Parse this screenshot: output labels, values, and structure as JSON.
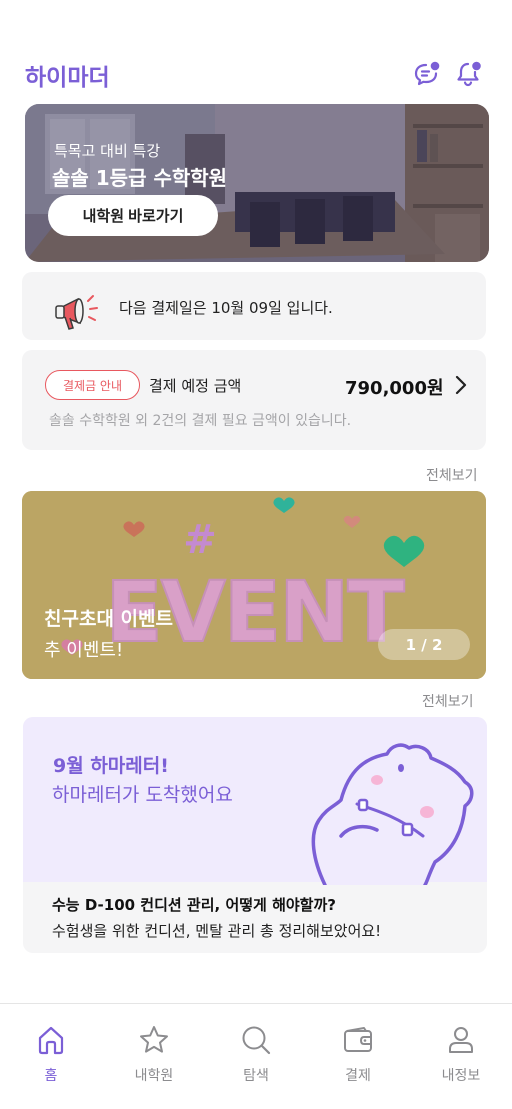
{
  "header": {
    "logo": "하이마더",
    "icons": [
      "chat-icon",
      "bell-icon"
    ]
  },
  "banner": {
    "subtitle": "특목고 대비 특강",
    "title": "솔솔 1등급 수학학원",
    "button_label": "내학원 바로가기"
  },
  "notice": {
    "text": "다음 결제일은 10월 09일 입니다.",
    "icon": "megaphone-icon"
  },
  "payment": {
    "badge": "결제금 안내",
    "label": "결제 예정 금액",
    "amount": "790,000원",
    "description": "솔솔 수학학원 외 2건의 결제 필요 금액이 있습니다."
  },
  "sections": {
    "see_all_1": "전체보기",
    "see_all_2": "전체보기"
  },
  "event": {
    "title": "친구초대 이벤트",
    "subtitle": "추 이벤트!",
    "pager": "1 / 2",
    "bg_color": "#bba564"
  },
  "letter": {
    "title": "9월 하마레터!",
    "subtitle": "하마레터가 도착했어요",
    "question": "수능 D-100 컨디션 관리, 어떻게 해야할까?",
    "description": "수험생을 위한 컨디션, 멘탈 관리 총 정리해보았어요!"
  },
  "tabbar": {
    "items": [
      {
        "label": "홈",
        "icon": "home-icon",
        "active": true
      },
      {
        "label": "내학원",
        "icon": "star-icon",
        "active": false
      },
      {
        "label": "탐색",
        "icon": "search-icon",
        "active": false
      },
      {
        "label": "결제",
        "icon": "wallet-icon",
        "active": false
      },
      {
        "label": "내정보",
        "icon": "user-icon",
        "active": false
      }
    ]
  },
  "colors": {
    "brand": "#7b5fd6",
    "alert": "#e8585f"
  }
}
